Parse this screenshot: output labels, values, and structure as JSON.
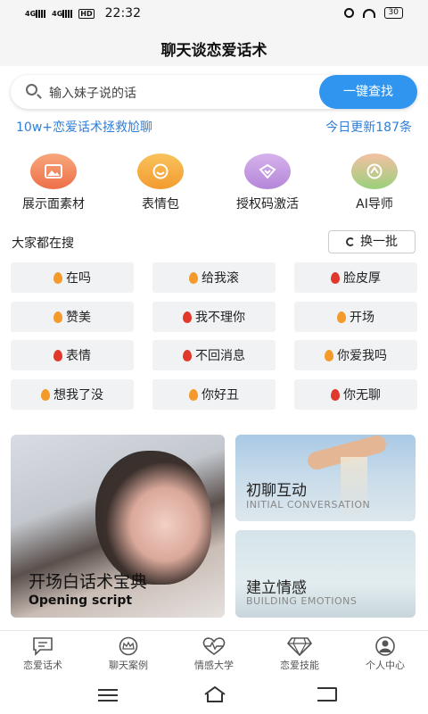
{
  "status_bar": {
    "network1": "4G",
    "network2": "4G",
    "hd": "HD",
    "time": "22:32",
    "battery": "30"
  },
  "header": {
    "title": "聊天谈恋爱话术"
  },
  "search": {
    "placeholder": "输入妹子说的话",
    "button": "一键查找"
  },
  "promo": {
    "left": "10w+恋爱话术拯救尬聊",
    "right": "今日更新187条"
  },
  "features": [
    {
      "label": "展示面素材",
      "icon": "image-icon",
      "color": "#f0875a"
    },
    {
      "label": "表情包",
      "icon": "smile-icon",
      "color": "#f5a53a"
    },
    {
      "label": "授权码激活",
      "icon": "heart-check-icon",
      "color": "#c59ae0"
    },
    {
      "label": "AI导师",
      "icon": "ai-icon",
      "color": "#8ccf6e"
    }
  ],
  "hot": {
    "title": "大家都在搜",
    "refresh": "换一批",
    "items": [
      {
        "label": "在吗",
        "flame": "orange"
      },
      {
        "label": "给我滚",
        "flame": "orange"
      },
      {
        "label": "脸皮厚",
        "flame": "red"
      },
      {
        "label": "赞美",
        "flame": "orange"
      },
      {
        "label": "我不理你",
        "flame": "red"
      },
      {
        "label": "开场",
        "flame": "orange"
      },
      {
        "label": "表情",
        "flame": "red"
      },
      {
        "label": "不回消息",
        "flame": "red"
      },
      {
        "label": "你爱我吗",
        "flame": "orange"
      },
      {
        "label": "想我了没",
        "flame": "orange"
      },
      {
        "label": "你好丑",
        "flame": "orange"
      },
      {
        "label": "你无聊",
        "flame": "red"
      }
    ]
  },
  "cards": {
    "big": {
      "title": "开场白话术宝典",
      "subtitle": "Opening script"
    },
    "small1": {
      "title": "初聊互动",
      "subtitle": "INITIAL CONVERSATION"
    },
    "small2": {
      "title": "建立情感",
      "subtitle": "BUILDING EMOTIONS"
    }
  },
  "tabs": [
    {
      "label": "恋爱话术",
      "icon": "chat-icon"
    },
    {
      "label": "聊天案例",
      "icon": "crown-icon"
    },
    {
      "label": "情感大学",
      "icon": "heartbeat-icon"
    },
    {
      "label": "恋爱技能",
      "icon": "diamond-icon"
    },
    {
      "label": "个人中心",
      "icon": "person-icon"
    }
  ]
}
